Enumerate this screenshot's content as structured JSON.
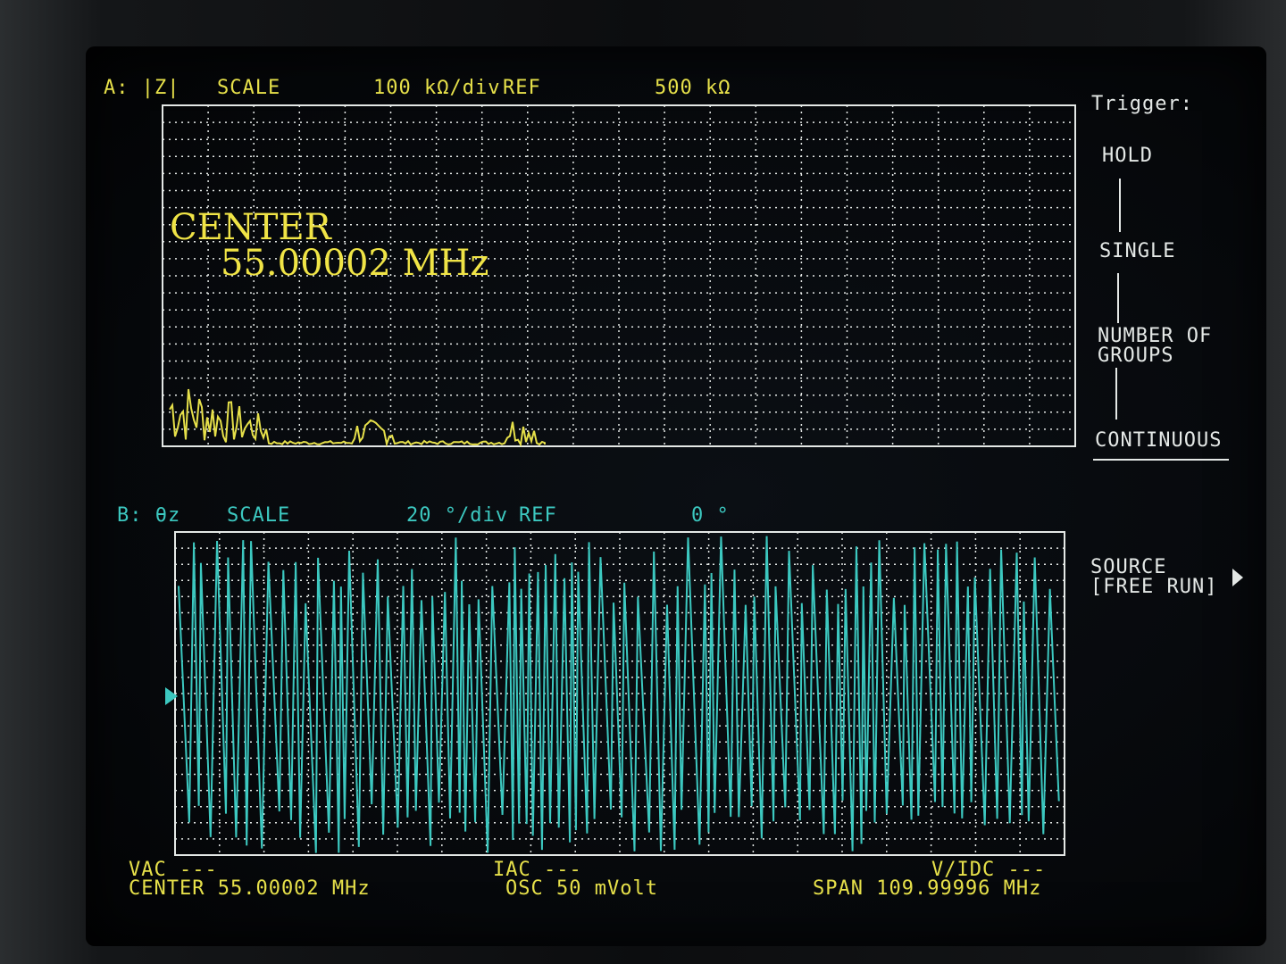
{
  "trace_a": {
    "label": "A: |Z|",
    "scale_label": "SCALE",
    "scale_value": "100 kΩ/div",
    "ref_label": "REF",
    "ref_value": "500 kΩ",
    "marker_title": "CENTER",
    "marker_value": "55.00002 MHz",
    "color": "#e6e04a"
  },
  "trace_b": {
    "label": "B: θz",
    "scale_label": "SCALE",
    "scale_value": "20 °/div",
    "ref_label": "REF",
    "ref_value": "0 °",
    "color": "#3cc8c0"
  },
  "softkeys": {
    "trigger_title": "Trigger:",
    "hold": "HOLD",
    "single": "SINGLE",
    "number_of_groups_1": "NUMBER OF",
    "number_of_groups_2": "GROUPS",
    "continuous": "CONTINUOUS",
    "source_1": "SOURCE",
    "source_2": "[FREE RUN]"
  },
  "status": {
    "vac": "VAC ---",
    "iac": "IAC ---",
    "vidc": "V/IDC ---",
    "center": "CENTER 55.00002 MHz",
    "osc": "OSC 50 mVolt",
    "span": "SPAN 109.99996 MHz"
  }
}
